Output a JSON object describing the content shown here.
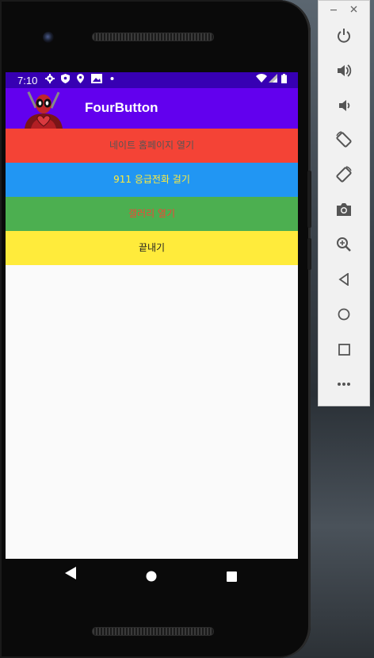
{
  "status_bar": {
    "time": "7:10",
    "icons": [
      "gear-icon",
      "shield-icon",
      "location-icon",
      "image-icon",
      "dot-icon",
      "wifi-icon",
      "signal-icon",
      "battery-icon"
    ]
  },
  "app_bar": {
    "title": "FourButton",
    "color": "#6200ee"
  },
  "buttons": [
    {
      "label": "네이트 홈페이지 열기",
      "bg": "#f44336",
      "fg": "#555555"
    },
    {
      "label": "911 응급전화 걸기",
      "bg": "#2196f3",
      "fg": "#ffeb3b"
    },
    {
      "label": "갤러리 열기",
      "bg": "#4caf50",
      "fg": "#f44336"
    },
    {
      "label": "끝내기",
      "bg": "#ffeb3b",
      "fg": "#222222"
    }
  ],
  "nav_bar": [
    "back-icon",
    "home-icon",
    "recents-icon"
  ],
  "emulator_toolbar": {
    "window_controls": [
      "minimize-icon",
      "close-icon"
    ],
    "tools": [
      "power-icon",
      "volume-up-icon",
      "volume-down-icon",
      "rotate-left-icon",
      "rotate-right-icon",
      "camera-icon",
      "zoom-icon",
      "back-icon",
      "home-icon",
      "overview-icon",
      "more-icon"
    ]
  }
}
